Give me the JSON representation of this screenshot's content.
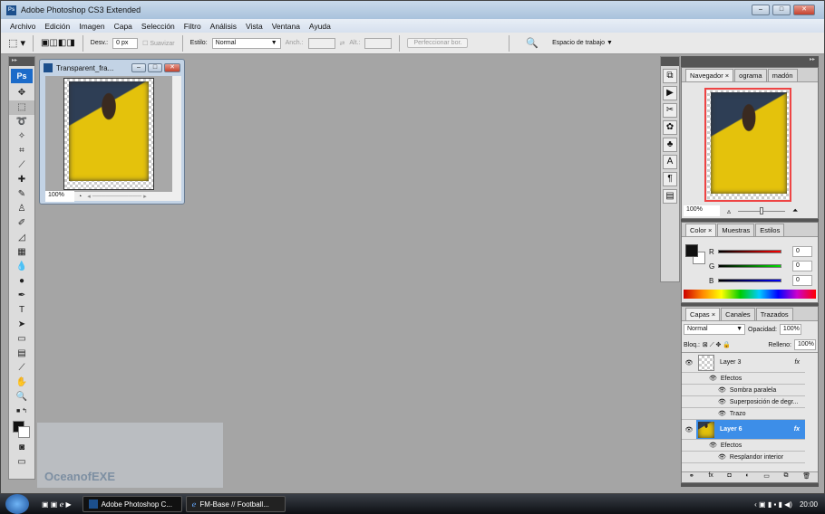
{
  "app": {
    "title": "Adobe Photoshop CS3 Extended",
    "logo": "Ps"
  },
  "menu": [
    "Archivo",
    "Edición",
    "Imagen",
    "Capa",
    "Selección",
    "Filtro",
    "Análisis",
    "Vista",
    "Ventana",
    "Ayuda"
  ],
  "options": {
    "feather_label": "Desv.:",
    "feather_value": "0 px",
    "antialias_label": "Suavizar",
    "style_label": "Estilo:",
    "style_value": "Normal",
    "width_label": "Anch.:",
    "height_label": "Alt.:",
    "refine_label": "Perfeccionar bor.",
    "workspace_label": "Espacio de trabajo"
  },
  "document": {
    "title": "Transparent_fra...",
    "zoom": "100%"
  },
  "navigator": {
    "tabs": [
      "Navegador",
      "ograma",
      "madón"
    ],
    "zoom": "100%"
  },
  "color": {
    "tabs": [
      "Color",
      "Muestras",
      "Estilos"
    ],
    "channels": [
      {
        "label": "R",
        "value": "0",
        "color": "#ff0000"
      },
      {
        "label": "G",
        "value": "0",
        "color": "#00dd00"
      },
      {
        "label": "B",
        "value": "0",
        "color": "#0000ff"
      }
    ]
  },
  "layers": {
    "tabs": [
      "Capas",
      "Canales",
      "Trazados"
    ],
    "blend": "Normal",
    "opacity_label": "Opacidad:",
    "opacity": "100%",
    "lock_label": "Bloq.:",
    "fill_label": "Relleno:",
    "fill": "100%",
    "items": [
      {
        "name": "Layer 3",
        "fx": "fx",
        "effects_label": "Efectos",
        "effects": [
          "Sombra paralela",
          "Superposición de degr...",
          "Trazo"
        ]
      },
      {
        "name": "Layer 6",
        "fx": "fx",
        "selected": true,
        "effects_label": "Efectos",
        "effects": [
          "Resplandor interior"
        ]
      }
    ]
  },
  "watermark": "OceanofEXE",
  "taskbar": {
    "items": [
      "Adobe Photoshop C...",
      "FM-Base // Football..."
    ],
    "clock": "20:00"
  }
}
